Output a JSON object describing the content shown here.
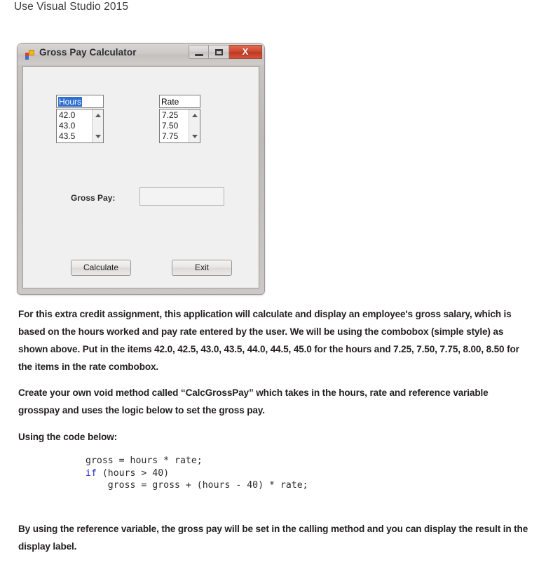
{
  "heading": "Use Visual Studio 2015",
  "form": {
    "title": "Gross Pay Calculator",
    "icon": "visual-studio-form-icon",
    "window_buttons": {
      "minimize": "–",
      "maximize": "❐",
      "close": "X"
    },
    "hours_combo": {
      "label": "Hours",
      "selected_text": "Hours",
      "is_text_selected": true,
      "items": [
        "42.0",
        "43.0",
        "43.5"
      ],
      "all_items": [
        "42.0",
        "42.5",
        "43.0",
        "43.5",
        "44.0",
        "44.5",
        "45.0"
      ]
    },
    "rate_combo": {
      "label": "Rate",
      "selected_text": "Rate",
      "is_text_selected": false,
      "items": [
        "7.25",
        "7.50",
        "7.75"
      ],
      "all_items": [
        "7.25",
        "7.50",
        "7.75",
        "8.00",
        "8.50"
      ]
    },
    "gross_pay_label": "Gross Pay:",
    "gross_pay_value": "",
    "calculate_button": "Calculate",
    "exit_button": "Exit"
  },
  "body": {
    "paragraph1": "For this extra credit assignment, this application will calculate and display an employee's gross salary, which is based on the hours worked and pay rate entered by the user.  We will be using the combobox (simple style) as shown above.  Put in the items 42.0, 42.5, 43.0, 43.5, 44.0, 44.5, 45.0 for the hours and 7.25, 7.50, 7.75, 8.00, 8.50 for the items in the rate combobox.",
    "paragraph2": "Create your own void method called “CalcGrossPay” which takes in the hours, rate and reference variable grosspay and uses the logic below to set the gross pay.",
    "paragraph3": "Using the code below:",
    "paragraph4": "By using the reference variable, the gross pay will be set in the calling method and you can display the result in the display label."
  },
  "code": {
    "line1": "gross = hours * rate;",
    "line2_keyword": "if",
    "line2_rest": " (hours > 40)",
    "line3": "    gross = gross + (hours - 40) * rate;"
  },
  "colors": {
    "keyword_blue": "#2b2bcc",
    "selection_blue": "#2f6fce",
    "close_button_red": "#cf4a30",
    "text": "#231f20"
  }
}
